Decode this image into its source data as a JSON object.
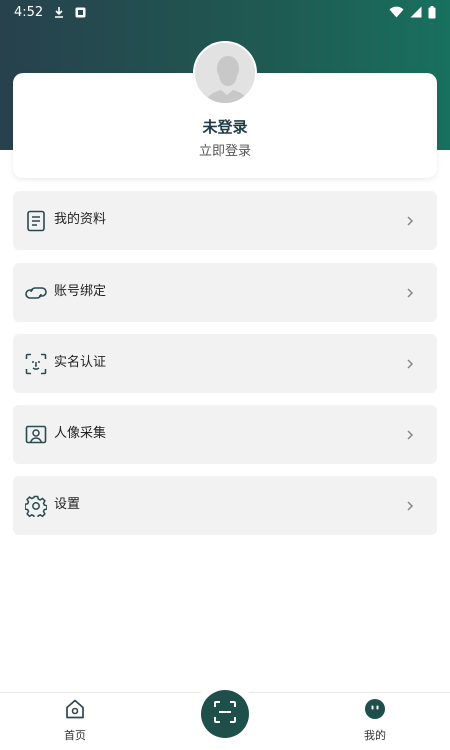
{
  "status_bar": {
    "time": "4:52"
  },
  "profile": {
    "name": "未登录",
    "login_prompt": "立即登录"
  },
  "menu": [
    {
      "label": "我的资料",
      "icon": "document-icon"
    },
    {
      "label": "账号绑定",
      "icon": "link-icon"
    },
    {
      "label": "实名认证",
      "icon": "face-scan-icon"
    },
    {
      "label": "人像采集",
      "icon": "portrait-icon"
    },
    {
      "label": "设置",
      "icon": "gear-icon"
    }
  ],
  "bottom_nav": {
    "home_label": "首页",
    "mine_label": "我的"
  },
  "colors": {
    "header_gradient_start": "#27414d",
    "header_gradient_end": "#18705e",
    "accent": "#1f4f4a",
    "card_bg": "#f2f2f2"
  }
}
